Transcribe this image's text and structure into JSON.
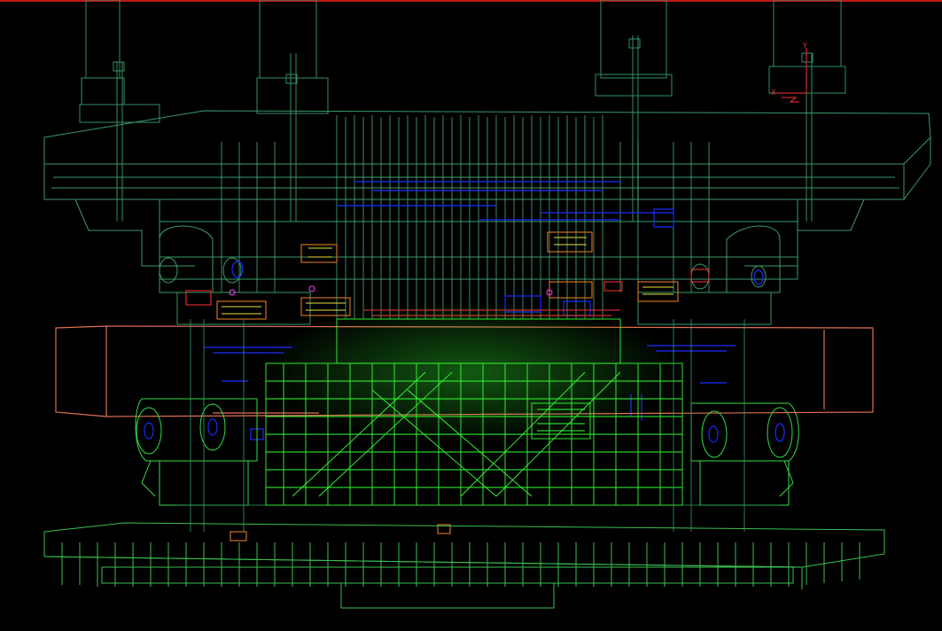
{
  "viewport": {
    "background": "#000000",
    "border_color": "#c01818",
    "render_mode": "wireframe"
  },
  "colors": {
    "frame_dark": "#2a8a5a",
    "frame_mid": "#3fbf6a",
    "frame_bright": "#33ff33",
    "blue_parts": "#1a2cff",
    "orange_parts": "#e07a20",
    "yellow_parts": "#e8e040",
    "red_parts": "#ff3030",
    "salmon_block": "#e07050",
    "magenta_parts": "#ff40ff"
  },
  "axis_triad": {
    "x_label": "X",
    "y_label": "Y",
    "x_color": "#ff3030",
    "y_color": "#ff3030"
  },
  "icons": [
    "axis-triad-icon"
  ]
}
